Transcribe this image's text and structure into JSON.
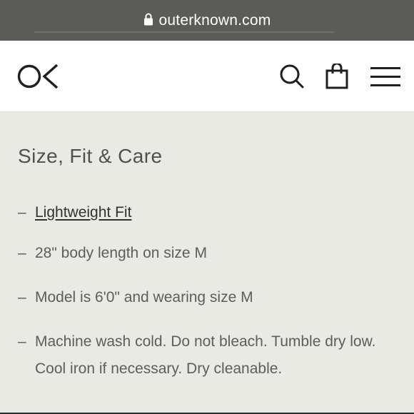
{
  "browser": {
    "url": "outerknown.com",
    "lock_icon": "lock-icon"
  },
  "header": {
    "logo_text": "OK",
    "icons": [
      "search-icon",
      "shopping-bag-icon",
      "hamburger-menu-icon"
    ]
  },
  "section": {
    "title": "Size, Fit & Care",
    "items": [
      {
        "dash": "–",
        "text": "Lightweight Fit"
      },
      {
        "dash": "–",
        "text": "28\" body length on size M"
      },
      {
        "dash": "–",
        "text": "Model is 6'0\" and wearing size M"
      },
      {
        "dash": "–",
        "text": "Machine wash cold. Do not bleach. Tumble dry low. Cool iron if necessary. Dry cleanable."
      }
    ]
  },
  "colors": {
    "browser_bar": "#5b5c58",
    "page_background": "#e9eae4",
    "header_background": "#ffffff",
    "text": "#5b5e5f",
    "link": "#2f3233"
  }
}
